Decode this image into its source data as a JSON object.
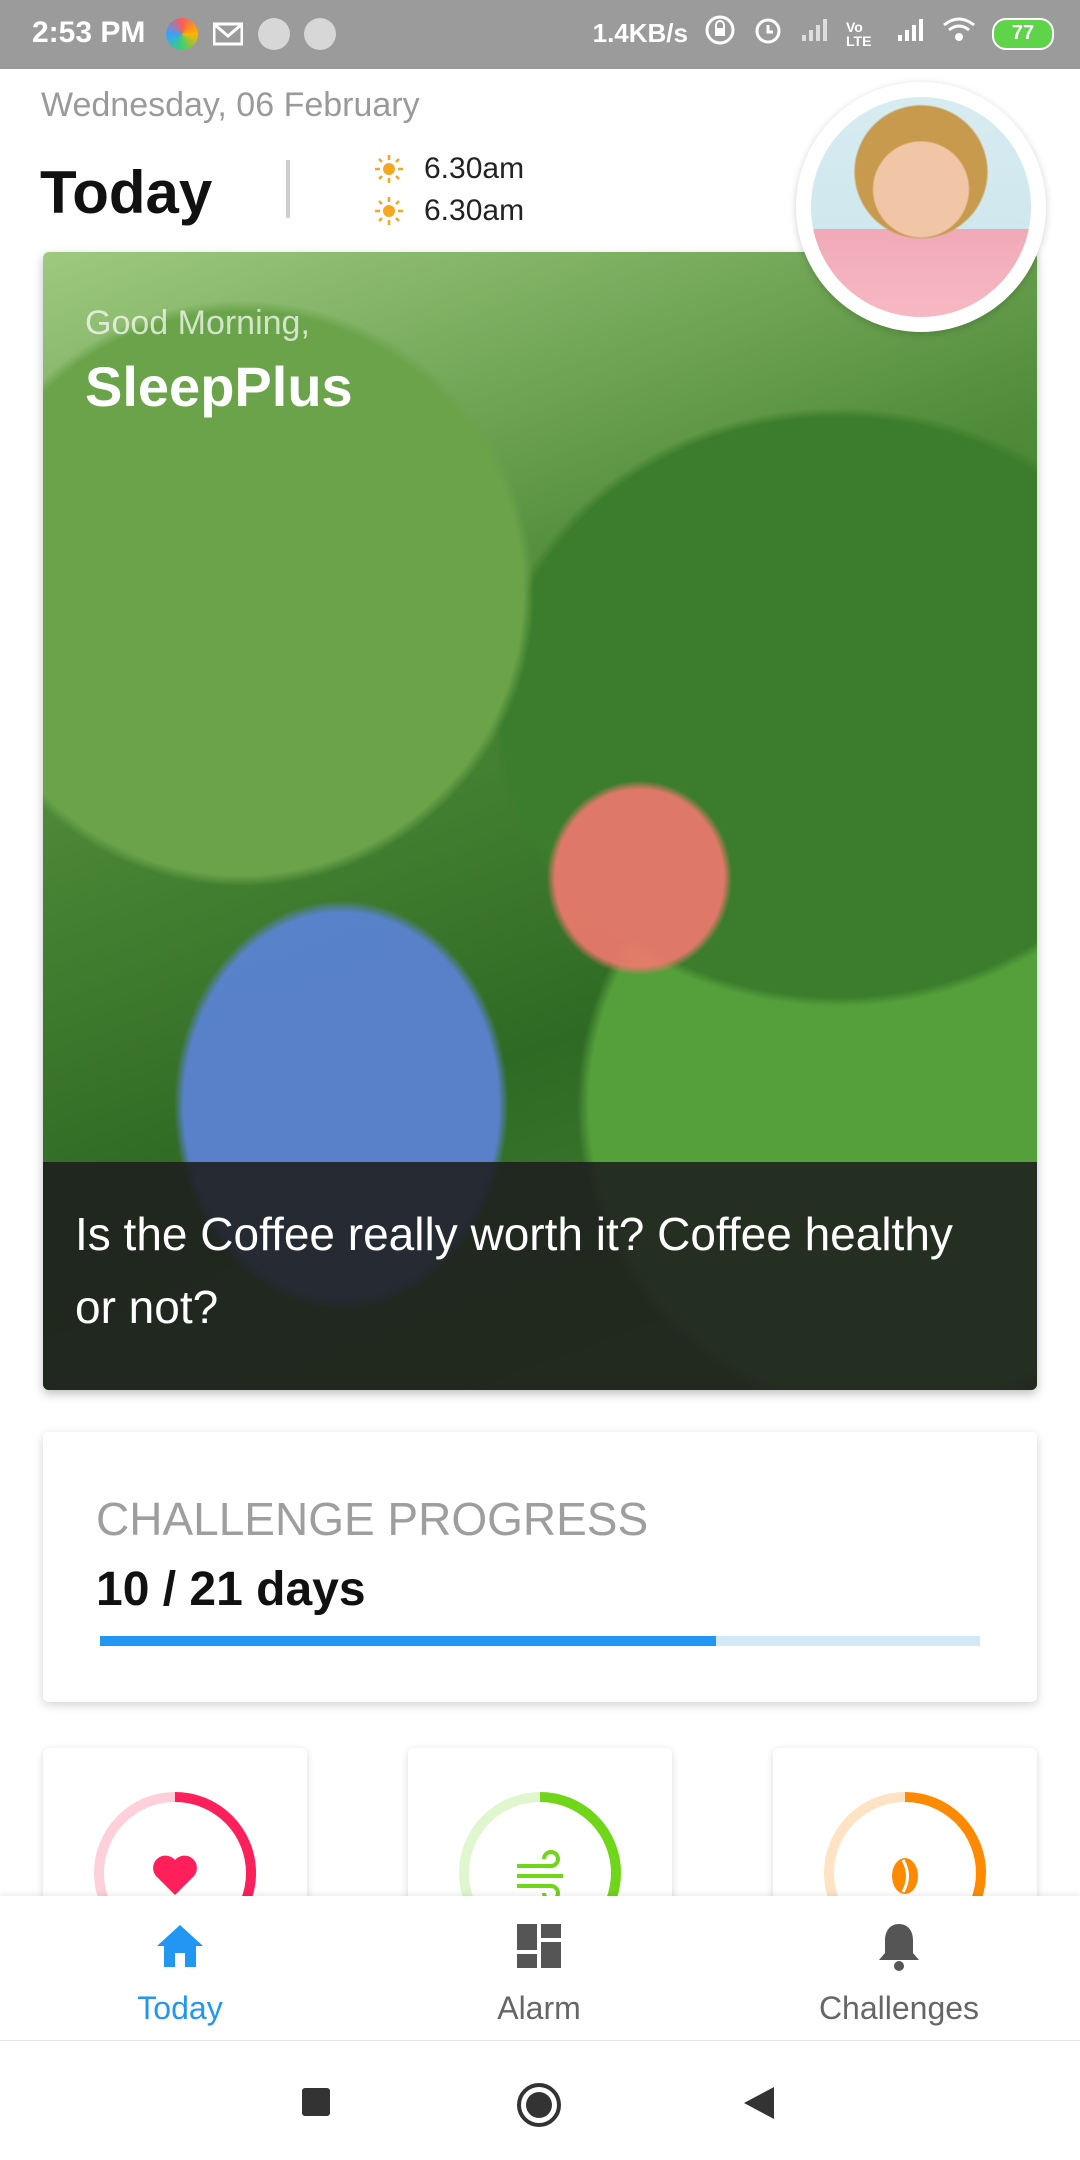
{
  "status_bar": {
    "time": "2:53 PM",
    "net_speed": "1.4KB/s",
    "volte": "Vo LTE",
    "battery": "77"
  },
  "header": {
    "date": "Wednesday, 06 February",
    "title": "Today",
    "times": [
      "6.30am",
      "6.30am"
    ],
    "sun_color": "#f5a623"
  },
  "hero": {
    "greeting": "Good Morning,",
    "brand": "SleepPlus",
    "caption": "Is the Coffee really worth it? Coffee healthy or not?"
  },
  "challenge": {
    "label": "CHALLENGE PROGRESS",
    "value_text": "10 / 21 days",
    "fraction": 0.7,
    "bar_color": "#2196f3"
  },
  "metrics": [
    {
      "icon": "heart-icon",
      "color": "#ff1f5a",
      "track": "#ffd0dc",
      "fraction": 0.5
    },
    {
      "icon": "wind-icon",
      "color": "#6fd61a",
      "track": "#dff6cf",
      "fraction": 0.5
    },
    {
      "icon": "coffee-bean-icon",
      "color": "#ff8a00",
      "track": "#ffe3c4",
      "fraction": 0.5
    }
  ],
  "nav": {
    "items": [
      {
        "label": "Today",
        "icon": "home-icon",
        "active": true
      },
      {
        "label": "Alarm",
        "icon": "dashboard-icon",
        "active": false
      },
      {
        "label": "Challenges",
        "icon": "bell-icon",
        "active": false
      }
    ],
    "active_color": "#2196f3"
  }
}
